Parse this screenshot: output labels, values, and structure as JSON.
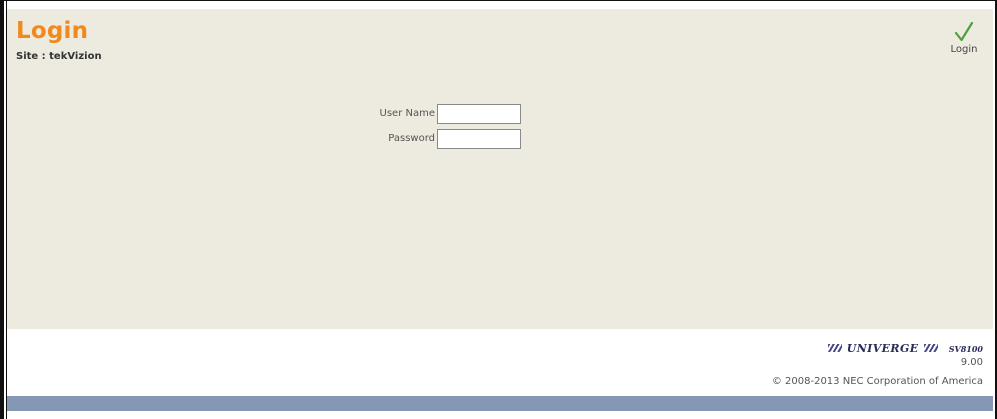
{
  "header": {
    "title": "Login",
    "site": "Site : tekVizion",
    "login_action_label": "Login",
    "login_action_icon": "checkmark-icon"
  },
  "form": {
    "username_label": "User Name",
    "username_value": "",
    "password_label": "Password",
    "password_value": ""
  },
  "footer": {
    "brand": "UNIVERGE",
    "model": "SV8100",
    "version": "9.00",
    "copyright": "© 2008-2013 NEC Corporation of America"
  },
  "colors": {
    "title": "#f08a1c",
    "panel_background": "#edeae0",
    "bottom_bar": "#8497b4",
    "checkmark": "#4aa23a"
  }
}
